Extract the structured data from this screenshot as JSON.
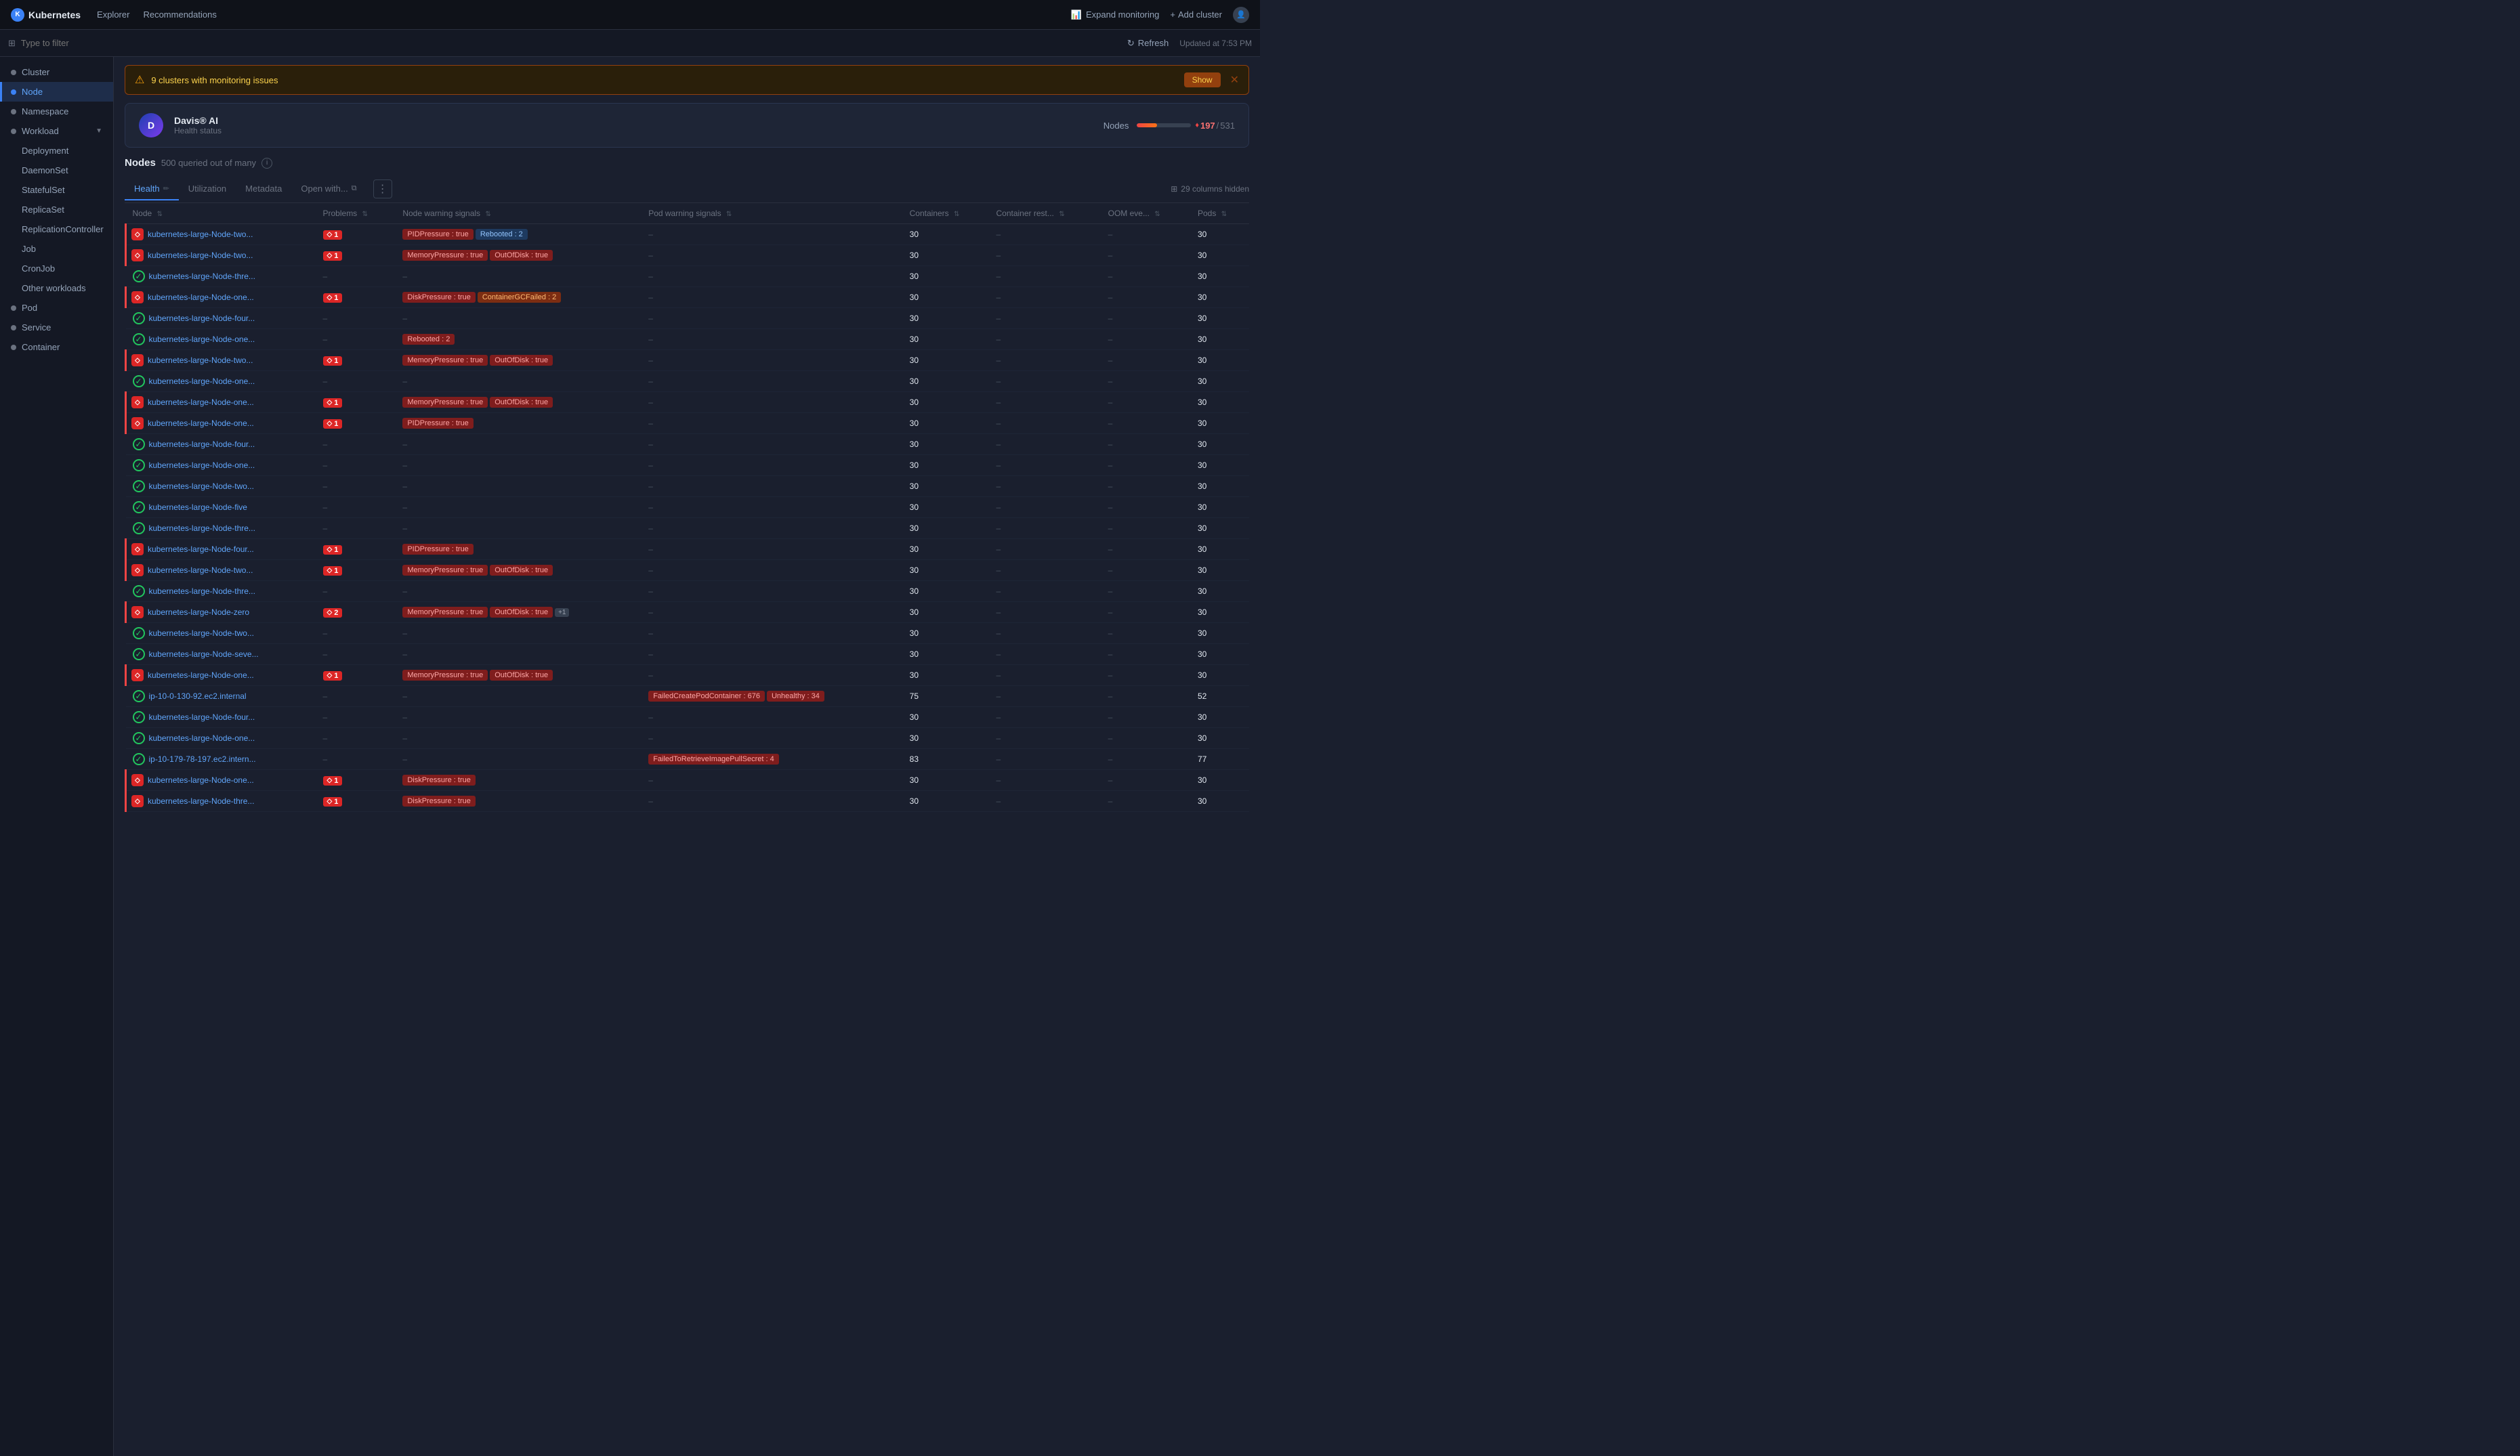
{
  "app": {
    "title": "Kubernetes",
    "nav_links": [
      "Explorer",
      "Recommendations"
    ],
    "expand_monitoring": "Expand monitoring",
    "add_cluster": "Add cluster"
  },
  "filter": {
    "placeholder": "Type to filter",
    "refresh": "Refresh",
    "updated": "Updated at 7:53 PM"
  },
  "alert": {
    "text": "9 clusters with monitoring issues",
    "show_label": "Show"
  },
  "davis": {
    "title": "Davis® AI",
    "subtitle": "Health status",
    "nodes_label": "Nodes",
    "nodes_bad": "197",
    "nodes_sep": "/",
    "nodes_total": "531",
    "nodes_pct": 37
  },
  "nodes_section": {
    "title": "Nodes",
    "query": "500 queried out of many"
  },
  "tabs": [
    {
      "label": "Health",
      "active": true,
      "editable": true
    },
    {
      "label": "Utilization",
      "active": false
    },
    {
      "label": "Metadata",
      "active": false
    },
    {
      "label": "Open with...",
      "active": false,
      "icon": true
    }
  ],
  "columns_hidden": "29 columns hidden",
  "table": {
    "headers": [
      {
        "label": "Node",
        "sortable": true
      },
      {
        "label": "Problems",
        "sortable": true
      },
      {
        "label": "Node warning signals",
        "sortable": true
      },
      {
        "label": "Pod warning signals",
        "sortable": true
      },
      {
        "label": "Containers",
        "sortable": true
      },
      {
        "label": "Container rest...",
        "sortable": true
      },
      {
        "label": "OOM eve...",
        "sortable": true
      },
      {
        "label": "Pods",
        "sortable": true
      }
    ],
    "rows": [
      {
        "name": "kubernetes-large-Node-two...",
        "error": true,
        "status": "error",
        "problem": "1",
        "node_warnings": [
          "PIDPressure : true"
        ],
        "node_extra": [
          "Rebooted : 2"
        ],
        "node_extra_type": "blue",
        "pod_warnings": [],
        "containers": "30",
        "container_rest": "–",
        "oom": "–",
        "pods": "30"
      },
      {
        "name": "kubernetes-large-Node-two...",
        "error": true,
        "status": "error",
        "problem": "1",
        "node_warnings": [
          "MemoryPressure : true",
          "OutOfDisk : true"
        ],
        "node_extra": [],
        "pod_warnings": [],
        "containers": "30",
        "container_rest": "–",
        "oom": "–",
        "pods": "30"
      },
      {
        "name": "kubernetes-large-Node-thre...",
        "error": false,
        "status": "ok",
        "problem": "",
        "node_warnings": [],
        "node_dash": true,
        "node_extra": [],
        "pod_warnings": [],
        "containers": "30",
        "container_rest": "–",
        "oom": "–",
        "pods": "30"
      },
      {
        "name": "kubernetes-large-Node-one...",
        "error": true,
        "status": "error",
        "problem": "1",
        "node_warnings": [
          "DiskPressure : true"
        ],
        "node_extra": [
          "ContainerGCFailed : 2"
        ],
        "node_extra_type": "orange",
        "pod_warnings": [],
        "containers": "30",
        "container_rest": "–",
        "oom": "–",
        "pods": "30"
      },
      {
        "name": "kubernetes-large-Node-four...",
        "error": false,
        "status": "ok",
        "problem": "",
        "node_warnings": [],
        "node_dash": true,
        "node_extra": [],
        "pod_warnings": [],
        "containers": "30",
        "container_rest": "–",
        "oom": "–",
        "pods": "30"
      },
      {
        "name": "kubernetes-large-Node-one...",
        "error": false,
        "status": "ok",
        "problem": "",
        "node_warnings": [
          "Rebooted : 2"
        ],
        "node_extra": [],
        "node_extra_type": "blue",
        "pod_warnings": [],
        "containers": "30",
        "container_rest": "–",
        "oom": "–",
        "pods": "30"
      },
      {
        "name": "kubernetes-large-Node-two...",
        "error": true,
        "status": "error",
        "problem": "1",
        "node_warnings": [
          "MemoryPressure : true",
          "OutOfDisk : true"
        ],
        "node_extra": [],
        "pod_warnings": [],
        "containers": "30",
        "container_rest": "–",
        "oom": "–",
        "pods": "30"
      },
      {
        "name": "kubernetes-large-Node-one...",
        "error": false,
        "status": "ok",
        "problem": "",
        "node_warnings": [],
        "node_dash": true,
        "node_extra": [],
        "pod_warnings": [],
        "containers": "30",
        "container_rest": "–",
        "oom": "–",
        "pods": "30"
      },
      {
        "name": "kubernetes-large-Node-one...",
        "error": true,
        "status": "error",
        "problem": "1",
        "node_warnings": [
          "MemoryPressure : true",
          "OutOfDisk : true"
        ],
        "node_extra": [],
        "pod_warnings": [],
        "containers": "30",
        "container_rest": "–",
        "oom": "–",
        "pods": "30"
      },
      {
        "name": "kubernetes-large-Node-one...",
        "error": true,
        "status": "error",
        "problem": "1",
        "node_warnings": [
          "PIDPressure : true"
        ],
        "node_extra": [],
        "pod_warnings": [],
        "containers": "30",
        "container_rest": "–",
        "oom": "–",
        "pods": "30"
      },
      {
        "name": "kubernetes-large-Node-four...",
        "error": false,
        "status": "ok",
        "problem": "",
        "node_warnings": [],
        "node_dash": true,
        "node_extra": [],
        "pod_warnings": [],
        "containers": "30",
        "container_rest": "–",
        "oom": "–",
        "pods": "30"
      },
      {
        "name": "kubernetes-large-Node-one...",
        "error": false,
        "status": "ok",
        "problem": "",
        "node_warnings": [],
        "node_dash": true,
        "node_extra": [],
        "pod_warnings": [],
        "containers": "30",
        "container_rest": "–",
        "oom": "–",
        "pods": "30"
      },
      {
        "name": "kubernetes-large-Node-two...",
        "error": false,
        "status": "ok",
        "problem": "",
        "node_warnings": [],
        "node_dash": true,
        "node_extra": [],
        "pod_warnings": [],
        "containers": "30",
        "container_rest": "–",
        "oom": "–",
        "pods": "30"
      },
      {
        "name": "kubernetes-large-Node-five",
        "error": false,
        "status": "ok",
        "problem": "",
        "node_warnings": [],
        "node_dash": true,
        "node_extra": [],
        "pod_warnings": [],
        "containers": "30",
        "container_rest": "–",
        "oom": "–",
        "pods": "30"
      },
      {
        "name": "kubernetes-large-Node-thre...",
        "error": false,
        "status": "ok",
        "problem": "",
        "node_warnings": [],
        "node_dash": true,
        "node_extra": [],
        "pod_warnings": [],
        "containers": "30",
        "container_rest": "–",
        "oom": "–",
        "pods": "30"
      },
      {
        "name": "kubernetes-large-Node-four...",
        "error": true,
        "status": "error",
        "problem": "1",
        "node_warnings": [
          "PIDPressure : true"
        ],
        "node_extra": [],
        "pod_warnings": [],
        "containers": "30",
        "container_rest": "–",
        "oom": "–",
        "pods": "30"
      },
      {
        "name": "kubernetes-large-Node-two...",
        "error": true,
        "status": "error",
        "problem": "1",
        "node_warnings": [
          "MemoryPressure : true",
          "OutOfDisk : true"
        ],
        "node_extra": [],
        "pod_warnings": [],
        "containers": "30",
        "container_rest": "–",
        "oom": "–",
        "pods": "30"
      },
      {
        "name": "kubernetes-large-Node-thre...",
        "error": false,
        "status": "ok",
        "problem": "",
        "node_warnings": [],
        "node_dash": true,
        "node_extra": [],
        "pod_warnings": [],
        "containers": "30",
        "container_rest": "–",
        "oom": "–",
        "pods": "30"
      },
      {
        "name": "kubernetes-large-Node-zero",
        "error": true,
        "status": "error",
        "problem": "2",
        "node_warnings": [
          "MemoryPressure : true",
          "OutOfDisk : true"
        ],
        "node_extra": [
          "+1"
        ],
        "node_extra_type": "plus",
        "pod_warnings": [],
        "containers": "30",
        "container_rest": "–",
        "oom": "–",
        "pods": "30"
      },
      {
        "name": "kubernetes-large-Node-two...",
        "error": false,
        "status": "ok",
        "problem": "",
        "node_warnings": [],
        "node_dash": true,
        "node_extra": [],
        "pod_warnings": [],
        "containers": "30",
        "container_rest": "–",
        "oom": "–",
        "pods": "30"
      },
      {
        "name": "kubernetes-large-Node-seve...",
        "error": false,
        "status": "ok",
        "problem": "",
        "node_warnings": [],
        "node_dash": true,
        "node_extra": [],
        "pod_warnings": [],
        "containers": "30",
        "container_rest": "–",
        "oom": "–",
        "pods": "30"
      },
      {
        "name": "kubernetes-large-Node-one...",
        "error": true,
        "status": "error",
        "problem": "1",
        "node_warnings": [
          "MemoryPressure : true",
          "OutOfDisk : true"
        ],
        "node_extra": [],
        "pod_warnings": [],
        "containers": "30",
        "container_rest": "–",
        "oom": "–",
        "pods": "30"
      },
      {
        "name": "ip-10-0-130-92.ec2.internal",
        "error": false,
        "status": "ok",
        "problem": "",
        "node_warnings": [],
        "node_dash": true,
        "node_extra": [],
        "pod_warnings": [
          "FailedCreatePodContainer : 676",
          "Unhealthy : 34"
        ],
        "containers": "75",
        "container_rest": "–",
        "oom": "–",
        "pods": "52"
      },
      {
        "name": "kubernetes-large-Node-four...",
        "error": false,
        "status": "ok",
        "problem": "",
        "node_warnings": [],
        "node_dash": true,
        "node_extra": [],
        "pod_warnings": [],
        "containers": "30",
        "container_rest": "–",
        "oom": "–",
        "pods": "30"
      },
      {
        "name": "kubernetes-large-Node-one...",
        "error": false,
        "status": "ok",
        "problem": "",
        "node_warnings": [],
        "node_dash": true,
        "node_extra": [],
        "pod_warnings": [],
        "containers": "30",
        "container_rest": "–",
        "oom": "–",
        "pods": "30"
      },
      {
        "name": "ip-10-179-78-197.ec2.intern...",
        "error": false,
        "status": "ok",
        "problem": "",
        "node_warnings": [],
        "node_dash": true,
        "node_extra": [],
        "pod_warnings": [
          "FailedToRetrieveImagePullSecret : 4"
        ],
        "containers": "83",
        "container_rest": "–",
        "oom": "–",
        "pods": "77"
      },
      {
        "name": "kubernetes-large-Node-one...",
        "error": true,
        "status": "error",
        "problem": "1",
        "node_warnings": [
          "DiskPressure : true"
        ],
        "node_extra": [],
        "pod_warnings": [],
        "containers": "30",
        "container_rest": "–",
        "oom": "–",
        "pods": "30"
      },
      {
        "name": "kubernetes-large-Node-thre...",
        "error": true,
        "status": "error",
        "problem": "1",
        "node_warnings": [
          "DiskPressure : true"
        ],
        "node_extra": [],
        "pod_warnings": [],
        "containers": "30",
        "container_rest": "–",
        "oom": "–",
        "pods": "30"
      }
    ]
  },
  "sidebar": {
    "items": [
      {
        "label": "Cluster",
        "type": "dot",
        "active": false
      },
      {
        "label": "Node",
        "type": "dot",
        "active": true
      },
      {
        "label": "Namespace",
        "type": "dot",
        "active": false
      },
      {
        "label": "Workload",
        "type": "section",
        "expandable": true,
        "active": false
      },
      {
        "label": "Deployment",
        "type": "sub",
        "active": false
      },
      {
        "label": "DaemonSet",
        "type": "sub",
        "active": false
      },
      {
        "label": "StatefulSet",
        "type": "sub",
        "active": false
      },
      {
        "label": "ReplicaSet",
        "type": "sub",
        "active": false
      },
      {
        "label": "ReplicationController",
        "type": "sub",
        "active": false
      },
      {
        "label": "Job",
        "type": "sub",
        "active": false
      },
      {
        "label": "CronJob",
        "type": "sub",
        "active": false
      },
      {
        "label": "Other workloads",
        "type": "sub",
        "active": false
      },
      {
        "label": "Pod",
        "type": "dot",
        "active": false
      },
      {
        "label": "Service",
        "type": "dot",
        "active": false
      },
      {
        "label": "Container",
        "type": "dot",
        "active": false
      }
    ]
  }
}
